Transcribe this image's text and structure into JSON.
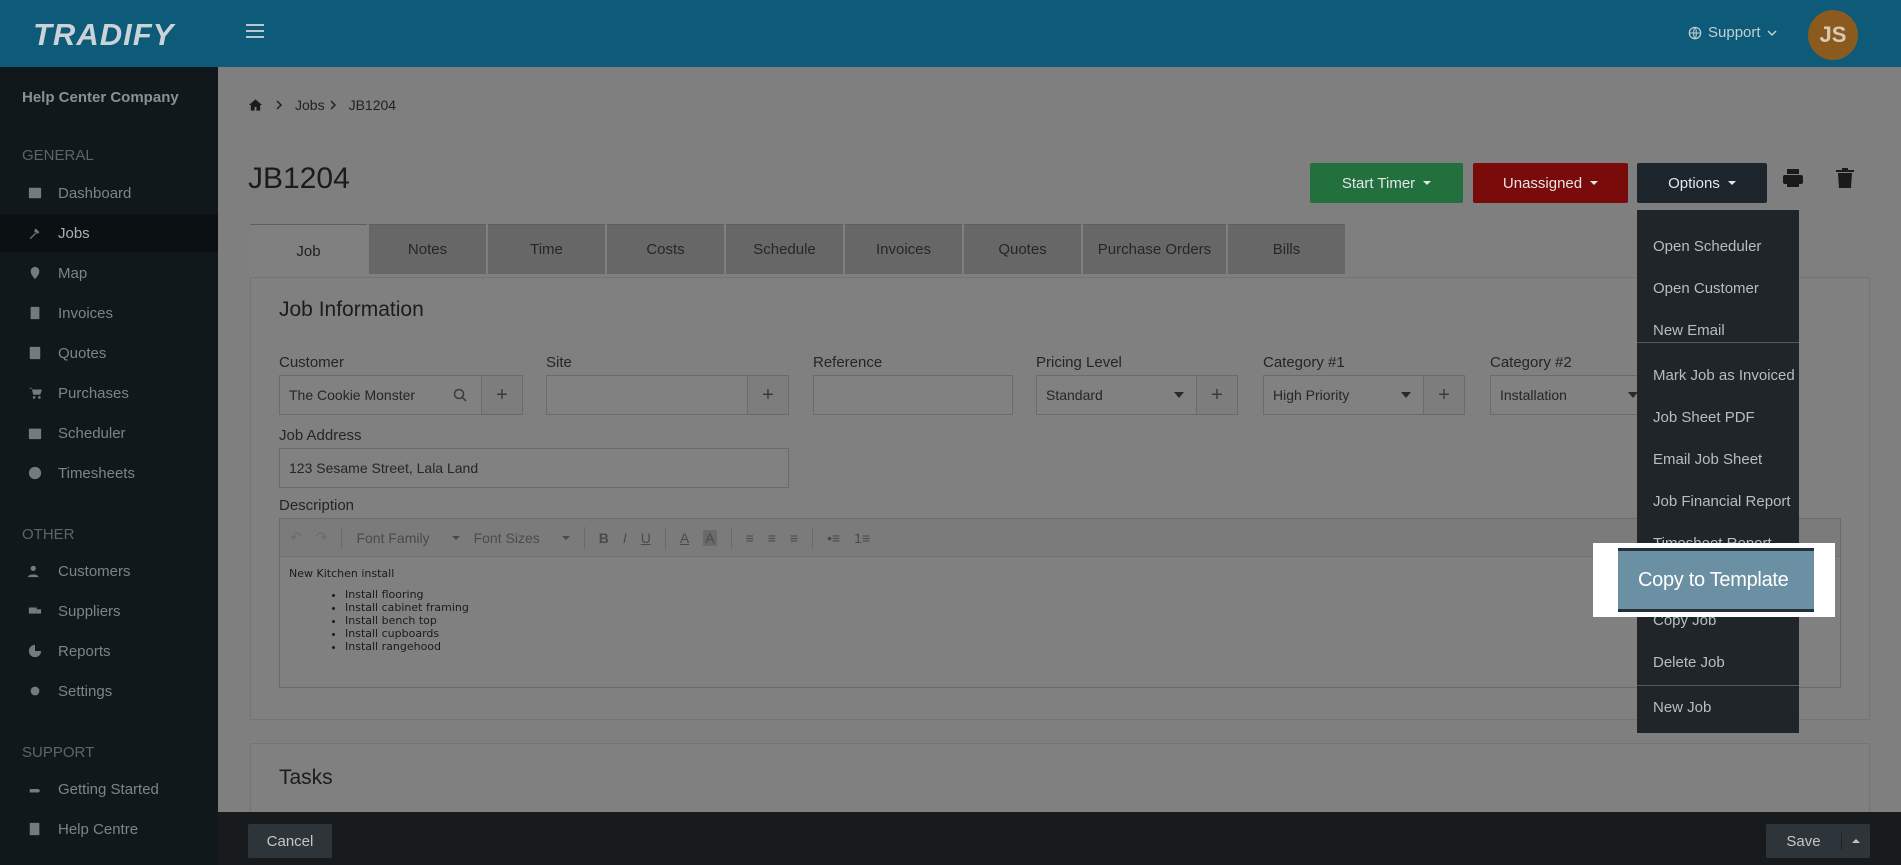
{
  "topbar": {
    "logo": "TRADIFY",
    "support_label": "Support",
    "avatar_initials": "JS"
  },
  "sidebar": {
    "company": "Help Center Company",
    "sections": {
      "general": "GENERAL",
      "other": "OTHER",
      "support": "SUPPORT"
    },
    "items": [
      {
        "label": "Dashboard",
        "icon": "dashboard-icon"
      },
      {
        "label": "Jobs",
        "icon": "wrench-icon"
      },
      {
        "label": "Map",
        "icon": "map-pin-icon"
      },
      {
        "label": "Invoices",
        "icon": "document-icon"
      },
      {
        "label": "Quotes",
        "icon": "calculator-icon"
      },
      {
        "label": "Purchases",
        "icon": "cart-icon"
      },
      {
        "label": "Scheduler",
        "icon": "calendar-icon"
      },
      {
        "label": "Timesheets",
        "icon": "clock-icon"
      },
      {
        "label": "Customers",
        "icon": "users-icon"
      },
      {
        "label": "Suppliers",
        "icon": "truck-icon"
      },
      {
        "label": "Reports",
        "icon": "pie-chart-icon"
      },
      {
        "label": "Settings",
        "icon": "gear-icon"
      },
      {
        "label": "Getting Started",
        "icon": "hand-pointer-icon"
      },
      {
        "label": "Help Centre",
        "icon": "book-icon"
      }
    ],
    "active": "Jobs"
  },
  "breadcrumb": {
    "jobs": "Jobs",
    "current": "JB1204"
  },
  "page": {
    "title": "JB1204",
    "start_timer": "Start Timer",
    "unassigned": "Unassigned",
    "options": "Options"
  },
  "tabs": [
    "Job",
    "Notes",
    "Time",
    "Costs",
    "Schedule",
    "Invoices",
    "Quotes",
    "Purchase Orders",
    "Bills"
  ],
  "job_info": {
    "title": "Job Information",
    "customer_label": "Customer",
    "customer_value": "The Cookie Monster",
    "site_label": "Site",
    "site_value": "",
    "reference_label": "Reference",
    "reference_value": "",
    "pricing_label": "Pricing Level",
    "pricing_value": "Standard",
    "cat1_label": "Category #1",
    "cat1_value": "High Priority",
    "cat2_label": "Category #2",
    "cat2_value": "Installation",
    "address_label": "Job Address",
    "address_value": "123 Sesame Street, Lala Land",
    "description_label": "Description"
  },
  "editor": {
    "font_family": "Font Family",
    "font_sizes": "Font Sizes",
    "intro": "New Kitchen install",
    "bullets": [
      "Install flooring",
      "Install cabinet framing",
      "Install bench top",
      "Install cupboards",
      "Install rangehood"
    ]
  },
  "tasks": {
    "title": "Tasks"
  },
  "footer": {
    "cancel": "Cancel",
    "save": "Save"
  },
  "options_menu": {
    "items": [
      "Open Scheduler",
      "Open Customer",
      "New Email",
      "Mark Job as Invoiced",
      "Job Sheet PDF",
      "Email Job Sheet",
      "Job Financial Report",
      "Timesheet Report",
      "Copy to Template",
      "Copy Job",
      "Delete Job",
      "New Job"
    ],
    "highlighted": "Copy to Template"
  }
}
